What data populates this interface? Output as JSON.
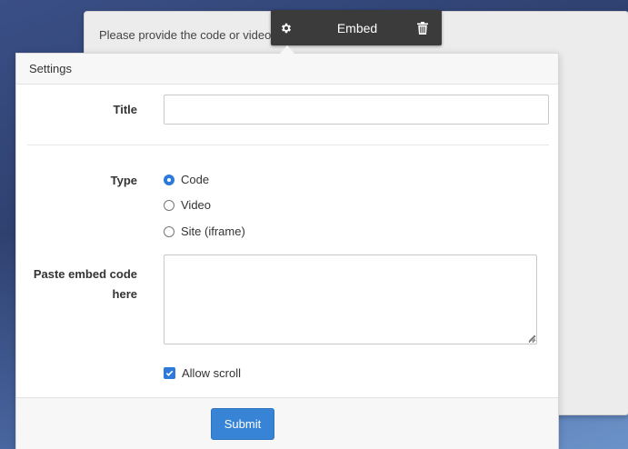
{
  "embed_block": {
    "prompt_text": "Please provide the code or video URL to embed."
  },
  "toolbar": {
    "title": "Embed",
    "settings_icon": "gear-icon",
    "delete_icon": "trash-icon",
    "background": "#3b3b3b"
  },
  "settings": {
    "header": "Settings",
    "title_label": "Title",
    "title_value": "",
    "type_label": "Type",
    "type_options": [
      {
        "label": "Code",
        "checked": true
      },
      {
        "label": "Video",
        "checked": false
      },
      {
        "label": "Site (iframe)",
        "checked": false
      }
    ],
    "embed_code_label_line1": "Paste embed code",
    "embed_code_label_line2": "here",
    "embed_code_value": "",
    "allow_scroll_label": "Allow scroll",
    "allow_scroll_checked": true,
    "submit_label": "Submit",
    "accent_color": "#3784d6"
  }
}
